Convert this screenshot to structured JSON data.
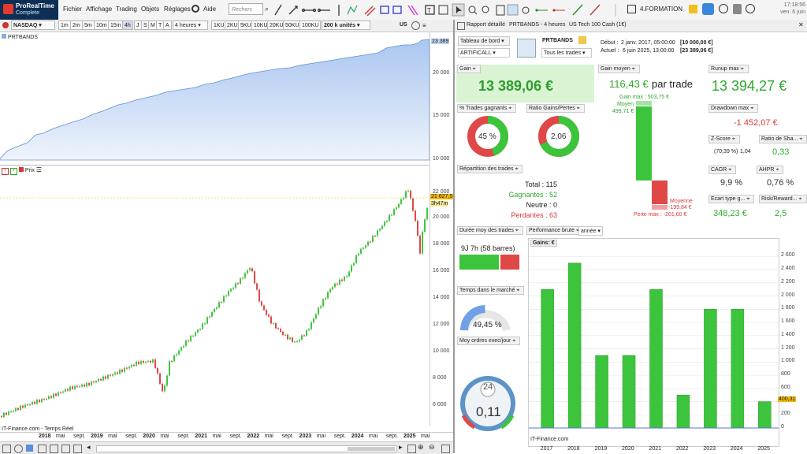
{
  "app": {
    "name": "ProRealTime",
    "edition": "Complete"
  },
  "menu": [
    "Fichier",
    "Affichage",
    "Trading",
    "Objets",
    "Réglages",
    "Aide"
  ],
  "search": {
    "placeholder": "Recherc"
  },
  "formation": "4.FORMATION",
  "clock": {
    "line1": "17:18:56",
    "line2": "ven. 6 juin"
  },
  "toolbar2": {
    "instrument": "NASDAQ",
    "timeframes": [
      "1m",
      "2m",
      "5m",
      "10m",
      "15m",
      "4h",
      "J",
      "S",
      "M",
      "T",
      "A"
    ],
    "period": "4 heures",
    "ticks": [
      "1KU",
      "2KU",
      "5KU",
      "10KU",
      "20KU",
      "50KU",
      "100KU"
    ],
    "units": "200 k unités",
    "market": "US"
  },
  "pane1": {
    "title": "PRTBANDS",
    "last": "23 389",
    "yticks": [
      "20 000",
      "15 000",
      "10 000"
    ]
  },
  "pane2": {
    "title": "Prix",
    "last": "21 627,5",
    "countdown": "3h47m",
    "yticks": [
      "22 000",
      "20 000",
      "18 000",
      "16 000",
      "14 000",
      "12 000",
      "10 000",
      "8 000",
      "6 000"
    ]
  },
  "xaxis": [
    "2018",
    "mai",
    "sept.",
    "2019",
    "mai",
    "sept.",
    "2020",
    "mai",
    "sept.",
    "2021",
    "mai",
    "sept.",
    "2022",
    "mai",
    "sept.",
    "2023",
    "mai",
    "sept.",
    "2024",
    "mai",
    "sept.",
    "2025",
    "mai"
  ],
  "source": "IT-Finance.com - Temps Réel",
  "report": {
    "header": {
      "title": "Rapport détaillé",
      "system": "PRTBANDS - 4 heures",
      "instrument": "US Tech 100 Cash (1€)"
    },
    "dashboard": "Tableau de bord",
    "account": "ARTIFICALL",
    "strategy": "PRTBANDS",
    "trades_filter": "Tous les trades",
    "debut_label": "Début :",
    "debut_date": "2 janv. 2017, 05:00:00",
    "debut_value": "[10 000,00 €]",
    "actuel_label": "Actuel :",
    "actuel_date": "6 juin 2025, 13:00:00",
    "actuel_value": "[23 389,06 €]",
    "gain_label": "Gain",
    "gain_value": "13 389,06 €",
    "gain_moyen_label": "Gain moyen",
    "gain_moyen_value": "116,43 €",
    "par_trade": "par trade",
    "gain_max": "Gain max : 503,75 €",
    "moyen_label": "Moyen",
    "moyen_value": "499,71 €",
    "moyenne_label": "Moyenne",
    "moyenne_value": "-199,84 €",
    "perte_max": "Perte max : -201,60 €",
    "runup_label": "Runup max",
    "runup_value": "13 394,27 €",
    "drawdown_label": "Drawdown max",
    "drawdown_value": "-1 452,07 €",
    "pct_trades_label": "% Trades gagnants",
    "pct_trades_value": "45 %",
    "pct_trades_fraction": 0.45,
    "ratio_label": "Ratio Gains/Pertes",
    "ratio_value": "2,06",
    "zscore_label": "Z-Score",
    "zscore_value": "(70,39 %)",
    "zscore_num": "1,04",
    "sharpe_label": "Ratio de Sha...",
    "sharpe_value": "0,33",
    "cagr_label": "CAGR",
    "cagr_value": "9,9 %",
    "ahpr_label": "AHPR",
    "ahpr_value": "0,76 %",
    "ecart_label": "Ecart type g...",
    "ecart_value": "348,23 €",
    "riskreward_label": "Risk/Reward...",
    "riskreward_value": "2,5",
    "repartition_label": "Répartition des trades",
    "total_label": "Total :",
    "total_value": "115",
    "gagnantes_label": "Gagnantes :",
    "gagnantes_value": "52",
    "neutre_label": "Neutre :",
    "neutre_value": "0",
    "perdantes_label": "Perdantes :",
    "perdantes_value": "63",
    "duree_label": "Durée moy des trades",
    "duree_value": "9J 7h (58 barres)",
    "perf_label": "Performance brute",
    "perf_period": "année",
    "temps_label": "Temps dans le marché",
    "temps_value": "49,45 %",
    "temps_fraction": 0.4945,
    "moy_ordres_label": "Moy ordres exec/jour",
    "moy_ordres_value": "0,11",
    "gauge_number": "24",
    "source": "IT-Finance.com",
    "colors": {
      "green": "#3cc43c",
      "red": "#e04848",
      "blue": "#6fa0e8"
    }
  },
  "chart_data": {
    "type": "bar",
    "title": "Gains: €",
    "categories": [
      "2017",
      "2018",
      "2019",
      "2020",
      "2021",
      "2022",
      "2023",
      "2024",
      "2025"
    ],
    "values": [
      2100,
      2500,
      1100,
      1100,
      2100,
      500,
      1800,
      1800,
      400
    ],
    "ylim": [
      0,
      2700
    ],
    "yticks": [
      "2 600",
      "2 400",
      "2 200",
      "2 000",
      "1 800",
      "1 600",
      "1 400",
      "1 200",
      "1 000",
      "800",
      "600",
      "400",
      "200",
      "0"
    ],
    "last_value": "400,31",
    "grid": true,
    "bar_color": "#3cc43c"
  }
}
